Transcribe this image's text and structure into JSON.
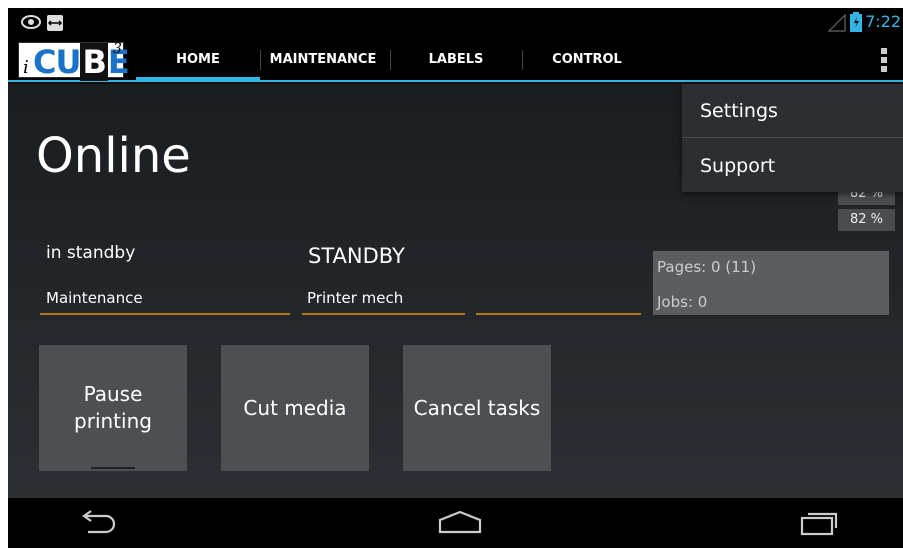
{
  "status_bar": {
    "time": "7:22",
    "icons": [
      "eye-icon",
      "screen-share-icon",
      "signal-icon",
      "battery-charging-icon"
    ]
  },
  "action_bar": {
    "logo": {
      "prefix": "i",
      "word": "CUBE",
      "superscript": "3"
    },
    "tabs": [
      {
        "label": "HOME",
        "active": true
      },
      {
        "label": "MAINTENANCE",
        "active": false
      },
      {
        "label": "LABELS",
        "active": false
      },
      {
        "label": "CONTROL",
        "active": false
      }
    ],
    "overflow_icon": "overflow-menu-icon",
    "accent_color": "#33b5e5"
  },
  "main": {
    "status_title": "Online",
    "percent_top": "82 %",
    "percent_bottom": "82 %",
    "state_text": "in standby",
    "state_code": "STANDBY",
    "maintenance_label": "Maintenance",
    "printer_mech_label": "Printer mech",
    "empty_field": "",
    "stats": {
      "pages": "Pages: 0  (11)",
      "jobs": "Jobs:   0"
    },
    "buttons": {
      "pause": [
        "Pause",
        "printing"
      ],
      "cut": "Cut media",
      "cancel": "Cancel tasks"
    }
  },
  "menu": {
    "items": [
      "Settings",
      "Support"
    ]
  },
  "nav_bar": {
    "icons": [
      "back-icon",
      "home-icon",
      "recent-apps-icon"
    ]
  }
}
